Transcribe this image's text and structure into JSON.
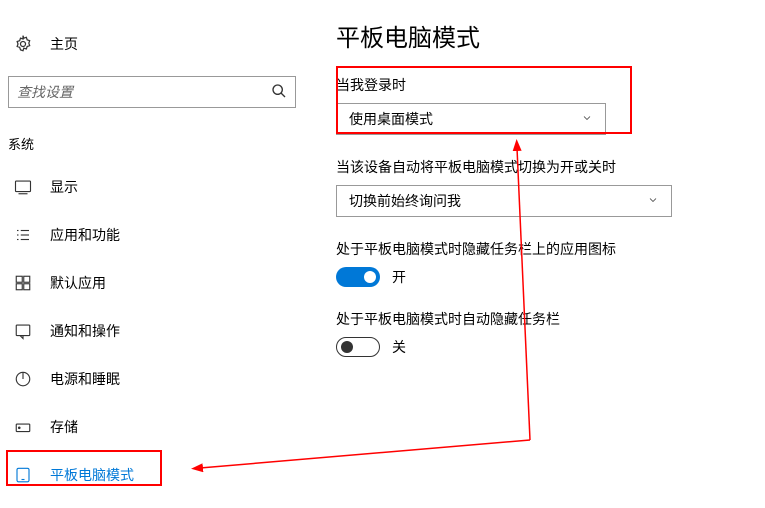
{
  "sidebar": {
    "home_label": "主页",
    "search_placeholder": "查找设置",
    "section_label": "系统",
    "items": [
      {
        "label": "显示"
      },
      {
        "label": "应用和功能"
      },
      {
        "label": "默认应用"
      },
      {
        "label": "通知和操作"
      },
      {
        "label": "电源和睡眠"
      },
      {
        "label": "存储"
      },
      {
        "label": "平板电脑模式"
      }
    ]
  },
  "main": {
    "title": "平板电脑模式",
    "signin_label": "当我登录时",
    "signin_value": "使用桌面模式",
    "auto_switch_label": "当该设备自动将平板电脑模式切换为开或关时",
    "auto_switch_value": "切换前始终询问我",
    "hide_icons_label": "处于平板电脑模式时隐藏任务栏上的应用图标",
    "hide_icons_state": "开",
    "hide_taskbar_label": "处于平板电脑模式时自动隐藏任务栏",
    "hide_taskbar_state": "关"
  },
  "colors": {
    "accent": "#0078d7",
    "annotation": "#ff0000"
  }
}
